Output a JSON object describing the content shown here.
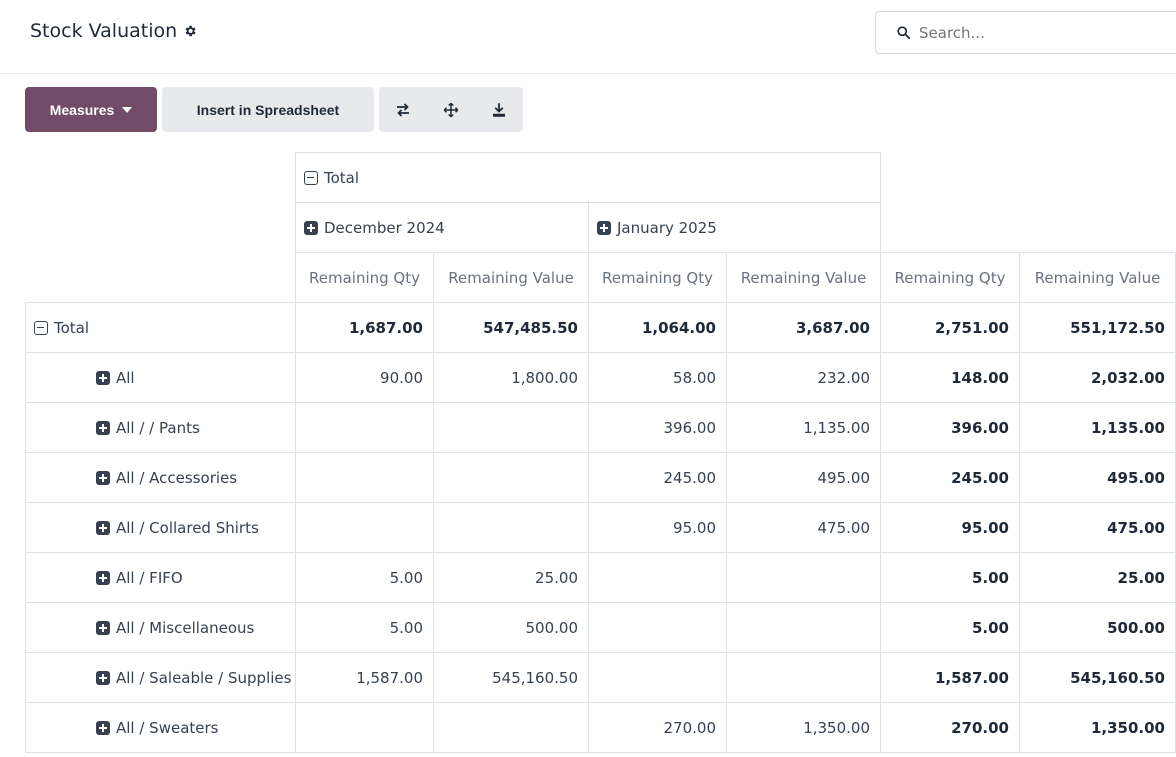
{
  "header": {
    "title": "Stock Valuation",
    "gear_icon": "gear-icon",
    "search_placeholder": "Search..."
  },
  "toolbar": {
    "measures_label": "Measures",
    "insert_label": "Insert in Spreadsheet",
    "icons": [
      "flip-axis-icon",
      "expand-all-icon",
      "download-icon"
    ]
  },
  "pivot": {
    "col_total_label": "Total",
    "col_groups": [
      "December 2024",
      "January 2025"
    ],
    "measure_labels": [
      "Remaining Qty",
      "Remaining Value"
    ],
    "row_total_label": "Total",
    "total_row": [
      "1,687.00",
      "547,485.50",
      "1,064.00",
      "3,687.00",
      "2,751.00",
      "551,172.50"
    ],
    "rows": [
      {
        "label": "All",
        "values": [
          "90.00",
          "1,800.00",
          "58.00",
          "232.00",
          "148.00",
          "2,032.00"
        ]
      },
      {
        "label": "All / / Pants",
        "values": [
          "",
          "",
          "396.00",
          "1,135.00",
          "396.00",
          "1,135.00"
        ]
      },
      {
        "label": "All / Accessories",
        "values": [
          "",
          "",
          "245.00",
          "495.00",
          "245.00",
          "495.00"
        ]
      },
      {
        "label": "All / Collared Shirts",
        "values": [
          "",
          "",
          "95.00",
          "475.00",
          "95.00",
          "475.00"
        ]
      },
      {
        "label": "All / FIFO",
        "values": [
          "5.00",
          "25.00",
          "",
          "",
          "5.00",
          "25.00"
        ]
      },
      {
        "label": "All / Miscellaneous",
        "values": [
          "5.00",
          "500.00",
          "",
          "",
          "5.00",
          "500.00"
        ]
      },
      {
        "label": "All / Saleable / Supplies",
        "values": [
          "1,587.00",
          "545,160.50",
          "",
          "",
          "1,587.00",
          "545,160.50"
        ]
      },
      {
        "label": "All / Sweaters",
        "values": [
          "",
          "",
          "270.00",
          "1,350.00",
          "270.00",
          "1,350.00"
        ]
      }
    ]
  },
  "colors": {
    "primary": "#714b67",
    "button_grey": "#e7e9ed",
    "border": "#dee2e6"
  }
}
